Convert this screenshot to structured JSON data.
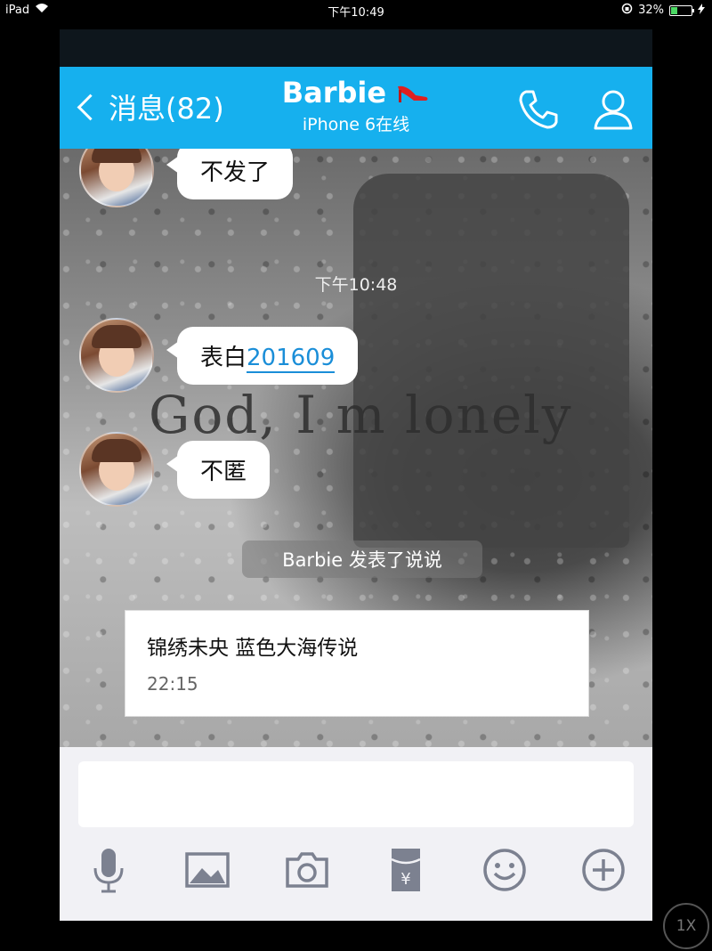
{
  "status_bar": {
    "device": "iPad",
    "time": "下午10:49",
    "battery": "32%",
    "battery_level": 0.32
  },
  "header": {
    "back_label": "消息(82)",
    "contact_name": "Barbie",
    "contact_status": "iPhone 6在线"
  },
  "chat": {
    "messages": [
      {
        "text": "不发了"
      },
      {
        "text_prefix": "表白",
        "text_link": "201609"
      },
      {
        "text": "不匿"
      }
    ],
    "timestamp": "下午10:48",
    "background_text": "God, I m lonely",
    "notice": "Barbie 发表了说说",
    "card": {
      "title": "锦绣未央 蓝色大海传说",
      "time": "22:15"
    }
  },
  "toolbar": {
    "icons": [
      "microphone-icon",
      "image-icon",
      "camera-icon",
      "red-packet-icon",
      "emoji-icon",
      "plus-icon"
    ]
  },
  "playback_rate": "1X",
  "colors": {
    "header": "#16b0ee",
    "link": "#1a8ed8",
    "toolbar_icon": "#7c8190"
  }
}
